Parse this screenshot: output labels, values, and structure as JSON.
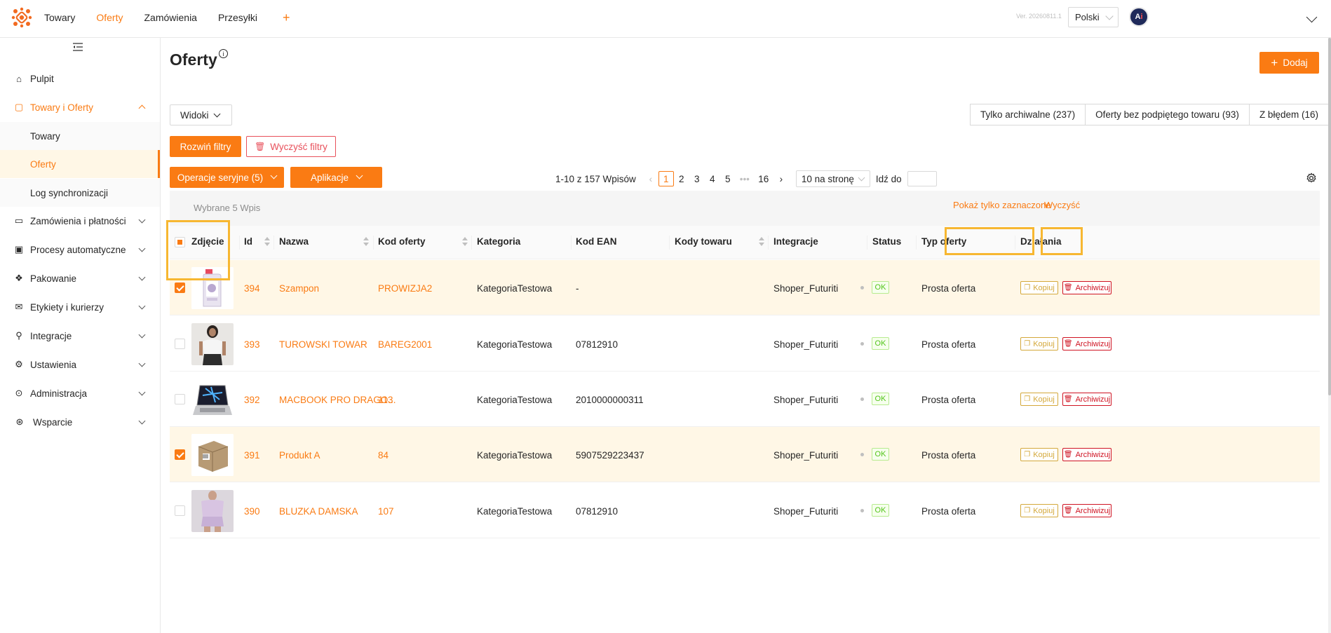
{
  "topbar": {
    "nav": [
      "Towary",
      "Oferty",
      "Zamówienia",
      "Przesyłki"
    ],
    "active_nav": 1,
    "plus": "+",
    "version": "Ver. 20260811.1",
    "language": "Polski",
    "avatar_text_a": "A",
    "avatar_text_i": "i"
  },
  "sidebar": {
    "items": [
      {
        "label": "Pulpit",
        "icon": "home-icon",
        "glyph": "⌂"
      },
      {
        "label": "Towary i Oferty",
        "icon": "bag-icon",
        "glyph": "▢"
      },
      {
        "label": "Zamówienia i płatności",
        "icon": "folder-icon",
        "glyph": "▭"
      },
      {
        "label": "Procesy automatyczne",
        "icon": "process-icon",
        "glyph": "▣"
      },
      {
        "label": "Pakowanie",
        "icon": "dropbox-icon",
        "glyph": "❖"
      },
      {
        "label": "Etykiety i kurierzy",
        "icon": "mail-icon",
        "glyph": "✉"
      },
      {
        "label": "Integracje",
        "icon": "plug-icon",
        "glyph": "⚲"
      },
      {
        "label": "Ustawienia",
        "icon": "settings-icon",
        "glyph": "⚙"
      },
      {
        "label": "Administracja",
        "icon": "admin-icon",
        "glyph": "⊙"
      },
      {
        "label": "Wsparcie",
        "icon": "support-icon",
        "glyph": "⊛"
      }
    ],
    "sub": [
      "Towary",
      "Oferty",
      "Log synchronizacji"
    ]
  },
  "main": {
    "title": "Oferty",
    "info": "i",
    "add_label": "Dodaj",
    "views_label": "Widoki",
    "quick_filters": [
      "Tylko archiwalne (237)",
      "Oferty bez podpiętego towaru (93)",
      "Z błędem (16)"
    ],
    "expand_filters": "Rozwiń filtry",
    "clear_filters": "Wyczyść filtry",
    "bulk_ops": "Operacje seryjne (5)",
    "apps": "Aplikacje",
    "pagination": {
      "summary": "1-10 z 157 Wpisów",
      "pages": [
        "1",
        "2",
        "3",
        "4",
        "5",
        "•••",
        "16"
      ],
      "per_page": "10 na stronę",
      "goto": "Idź do"
    },
    "selection": {
      "text": "Wybrane  5  Wpis",
      "show_selected": "Pokaż tylko zaznaczone",
      "clear": "Wyczyść"
    },
    "columns": [
      "Zdjęcie",
      "Id",
      "Nazwa",
      "Kod oferty",
      "Kategoria",
      "Kod EAN",
      "Kody towaru",
      "Integracje",
      "Status",
      "Typ oferty",
      "Działania"
    ],
    "rows": [
      {
        "id": "394",
        "name": "Szampon",
        "code": "PROWIZJA2",
        "category": "KategoriaTestowa",
        "ean": "-",
        "integration": "Shoper_Futuriti",
        "status": "OK",
        "type": "Prosta oferta",
        "selected": true,
        "img": "bottle"
      },
      {
        "id": "393",
        "name": "TUROWSKI TOWAR",
        "code": "BAREG2001",
        "category": "KategoriaTestowa",
        "ean": "07812910",
        "integration": "Shoper_Futuriti",
        "status": "OK",
        "type": "Prosta oferta",
        "selected": false,
        "img": "person"
      },
      {
        "id": "392",
        "name": "MACBOOK PRO DRAGO...",
        "code": "113",
        "category": "KategoriaTestowa",
        "ean": "2010000000311",
        "integration": "Shoper_Futuriti",
        "status": "OK",
        "type": "Prosta oferta",
        "selected": false,
        "img": "laptop"
      },
      {
        "id": "391",
        "name": "Produkt A",
        "code": "84",
        "category": "KategoriaTestowa",
        "ean": "5907529223437",
        "integration": "Shoper_Futuriti",
        "status": "OK",
        "type": "Prosta oferta",
        "selected": true,
        "img": "box"
      },
      {
        "id": "390",
        "name": "BLUZKA DAMSKA",
        "code": "107",
        "category": "KategoriaTestowa",
        "ean": "07812910",
        "integration": "Shoper_Futuriti",
        "status": "OK",
        "type": "Prosta oferta",
        "selected": false,
        "img": "pajama"
      }
    ],
    "copy_label": "Kopiuj",
    "archive_label": "Archiwizuj"
  },
  "colors": {
    "accent": "#fa7b13",
    "highlight": "#f7b731",
    "danger": "#cf1322",
    "ok": "#52c41a"
  }
}
